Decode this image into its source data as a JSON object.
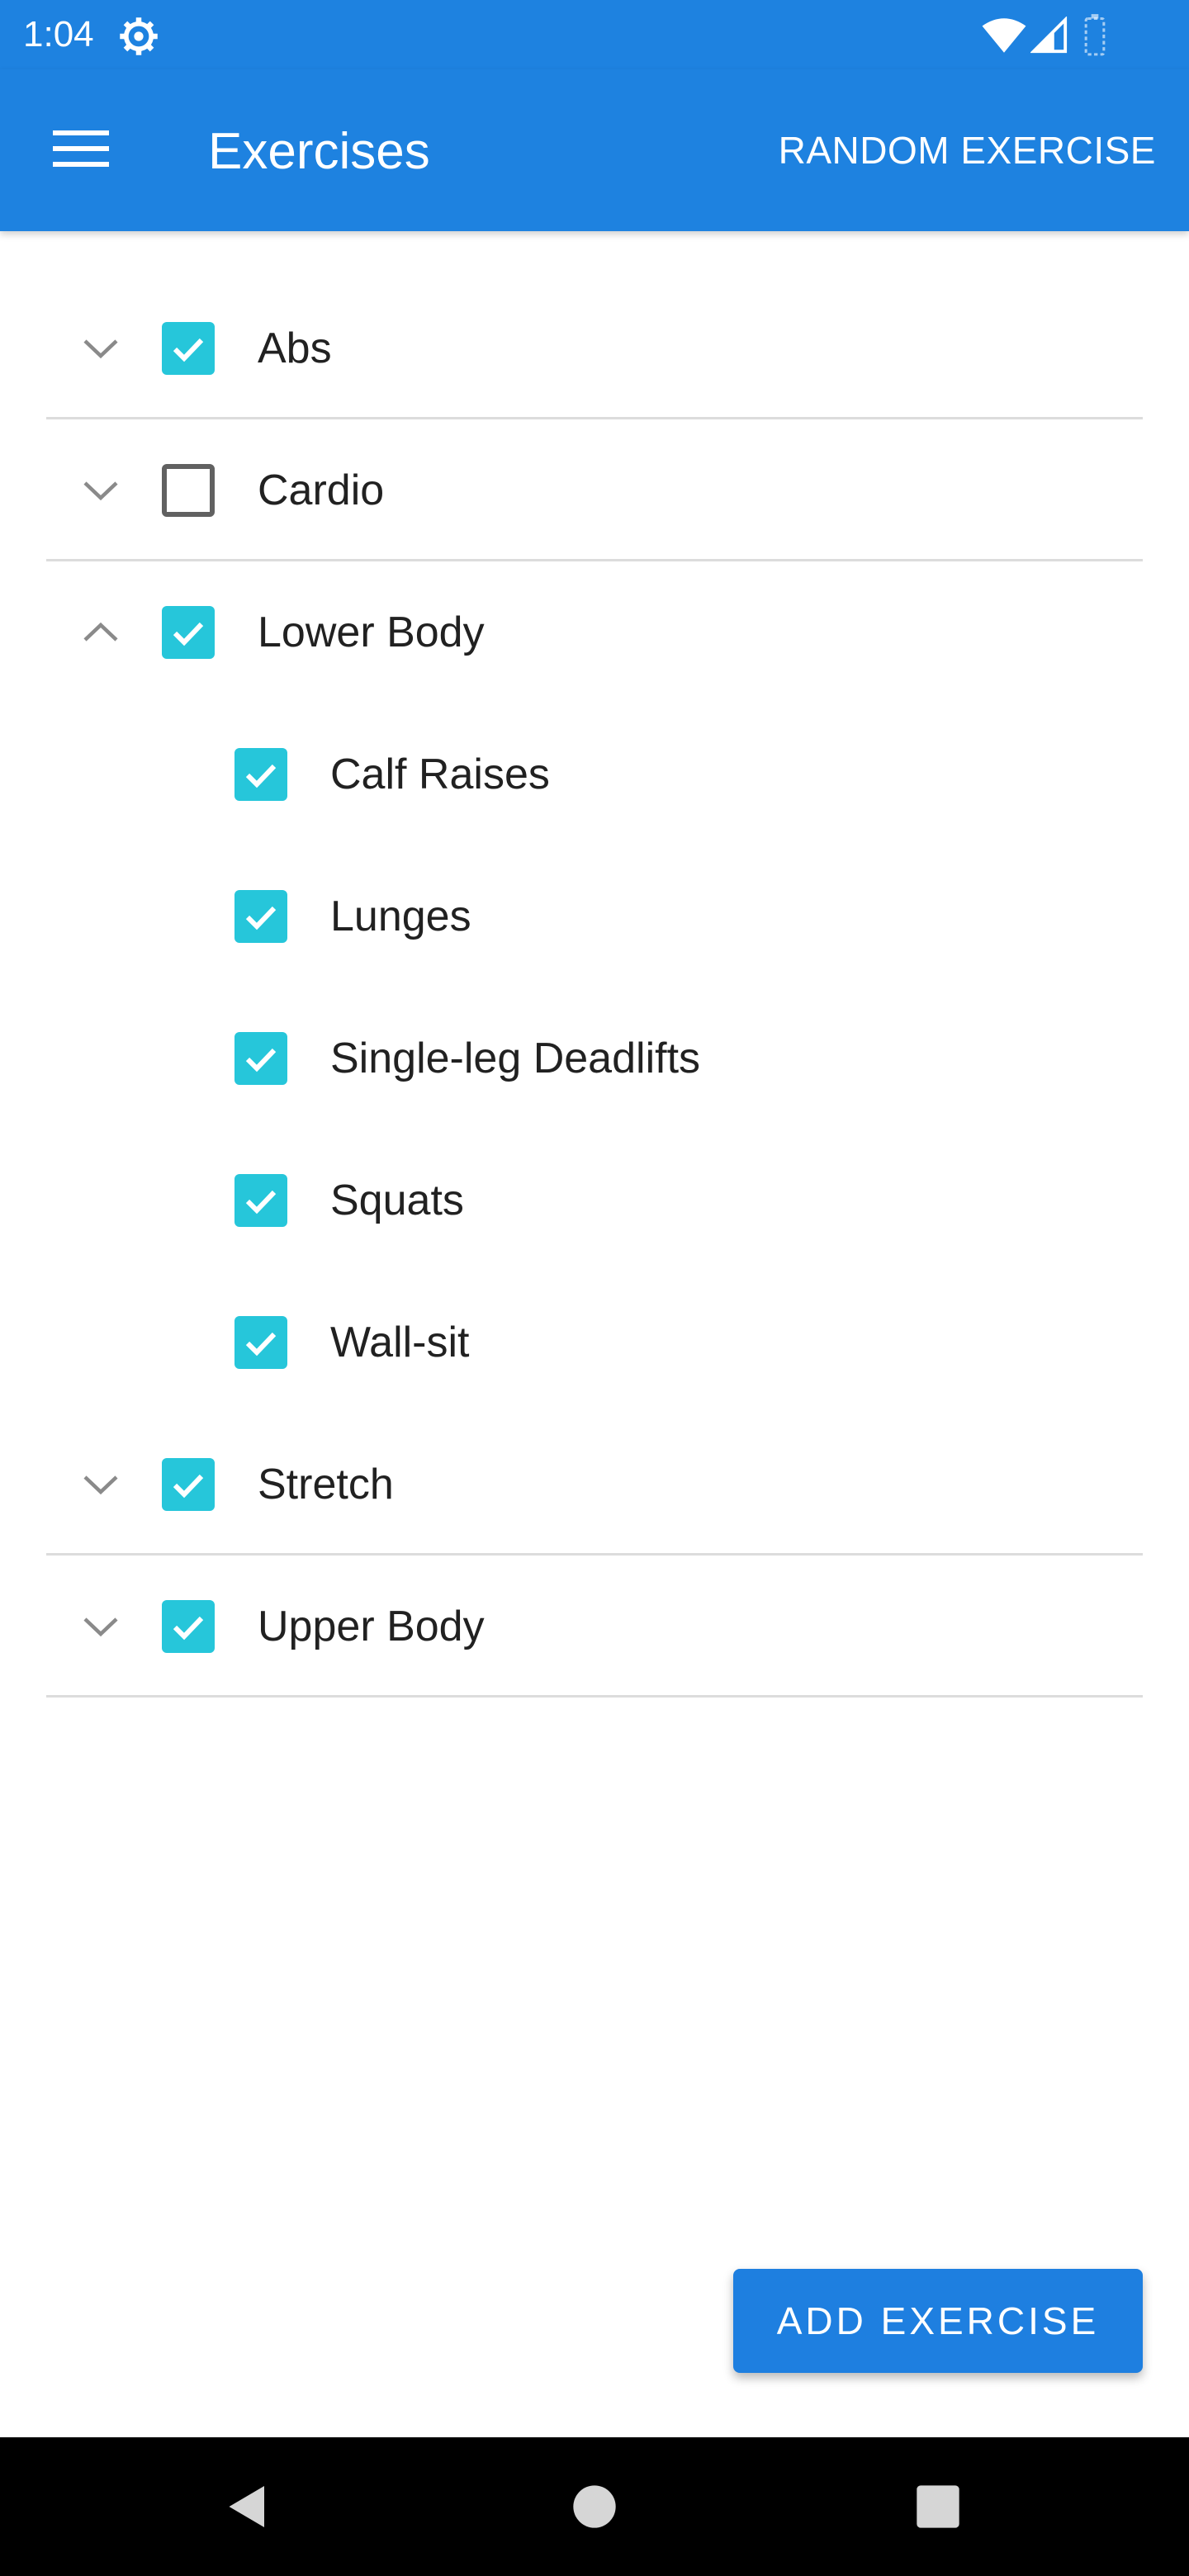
{
  "status_bar": {
    "time": "1:04",
    "icons": [
      "settings-gear-icon",
      "wifi-icon",
      "cell-signal-icon",
      "battery-icon"
    ]
  },
  "app_bar": {
    "title": "Exercises",
    "menu_icon": "hamburger-menu-icon",
    "action_label": "RANDOM EXERCISE"
  },
  "categories": [
    {
      "label": "Abs",
      "checked": true,
      "expanded": false
    },
    {
      "label": "Cardio",
      "checked": false,
      "expanded": false
    },
    {
      "label": "Lower Body",
      "checked": true,
      "expanded": true,
      "children": [
        {
          "label": "Calf Raises",
          "checked": true
        },
        {
          "label": "Lunges",
          "checked": true
        },
        {
          "label": "Single-leg Deadlifts",
          "checked": true
        },
        {
          "label": "Squats",
          "checked": true
        },
        {
          "label": "Wall-sit",
          "checked": true
        }
      ]
    },
    {
      "label": "Stretch",
      "checked": true,
      "expanded": false
    },
    {
      "label": "Upper Body",
      "checked": true,
      "expanded": false
    }
  ],
  "fab": {
    "label": "ADD EXERCISE"
  },
  "colors": {
    "primary": "#1e82e0",
    "checkbox_accent": "#26c6da",
    "divider": "#dcdcdc"
  }
}
